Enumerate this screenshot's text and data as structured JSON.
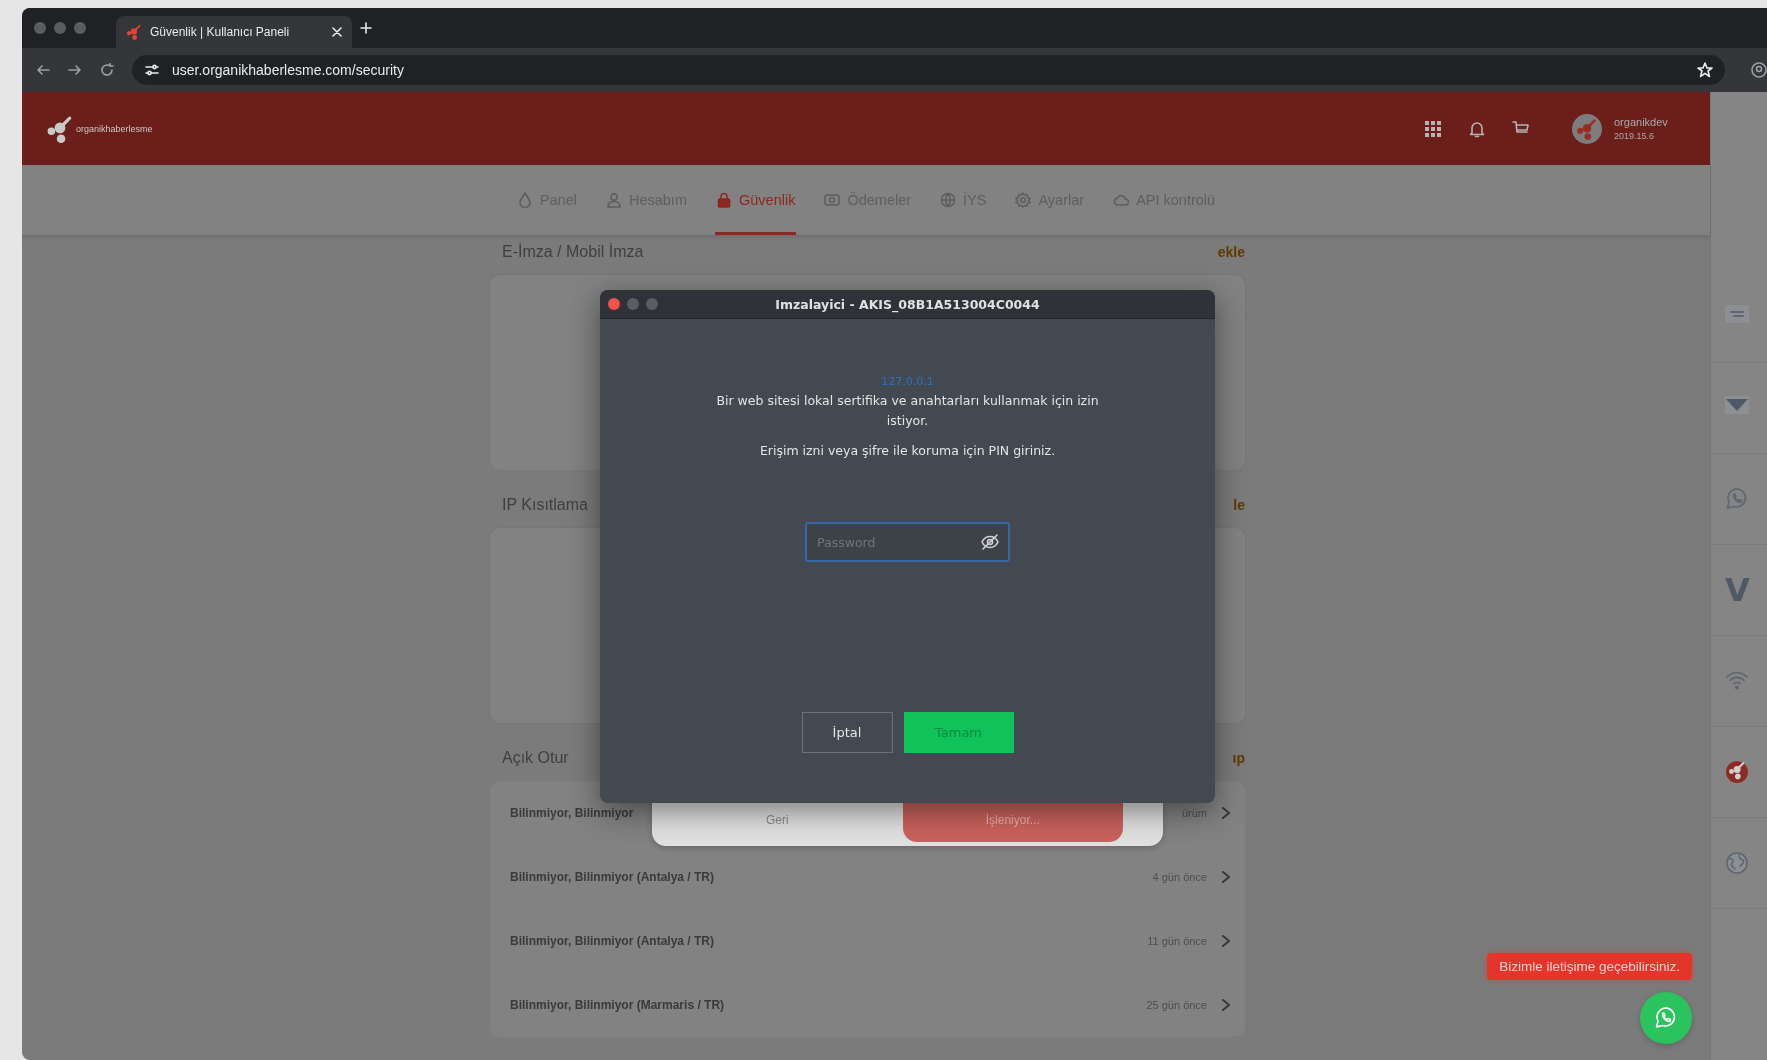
{
  "browser": {
    "tab_title": "Güvenlik | Kullanıcı Paneli",
    "url": "user.organikhaberlesme.com/security"
  },
  "header": {
    "logo_text": "organikhaberlesme",
    "user_name": "organikdev",
    "user_version": "2019.15.6"
  },
  "nav": [
    {
      "label": "Panel",
      "selected": false
    },
    {
      "label": "Hesabım",
      "selected": false
    },
    {
      "label": "Güvenlik",
      "selected": true
    },
    {
      "label": "Ödemeler",
      "selected": false
    },
    {
      "label": "İYS",
      "selected": false
    },
    {
      "label": "Ayarlar",
      "selected": false
    },
    {
      "label": "API kontrolü",
      "selected": false
    }
  ],
  "sections": [
    {
      "title": "E-İmza / Mobil İmza",
      "action": "ekle"
    },
    {
      "title": "IP Kısıtlama",
      "action": "le"
    },
    {
      "title": "Açık Otur",
      "action": "ıp"
    }
  ],
  "sessions": [
    {
      "device": "Bilinmiyor, Bilinmiyor",
      "time": "ürüm"
    },
    {
      "device": "Bilinmiyor, Bilinmiyor (Antalya / TR)",
      "time": "4 gün önce"
    },
    {
      "device": "Bilinmiyor, Bilinmiyor (Antalya / TR)",
      "time": "11 gün önce"
    },
    {
      "device": "Bilinmiyor, Bilinmiyor (Marmaris / TR)",
      "time": "25 gün önce"
    }
  ],
  "back_sheet": {
    "buttons": [
      {
        "label": "Geri",
        "kind": "plain"
      },
      {
        "label": "İşleniyor...",
        "kind": "danger"
      }
    ]
  },
  "dialog": {
    "title": "Imzalayici - AKIS_08B1A513004C0044",
    "host": "127.0.0.1",
    "message": "Bir web sitesi lokal sertifika ve anahtarları kullanmak için izin istiyor.",
    "prompt": "Erişim izni veya şifre ile koruma için PIN giriniz.",
    "password": {
      "placeholder": "Password"
    },
    "buttons": [
      {
        "label": "İptal",
        "kind": "secondary"
      },
      {
        "label": "Tamam",
        "kind": "primary"
      }
    ]
  },
  "side_rail": [
    {
      "kind": "lines"
    },
    {
      "kind": "triangle"
    },
    {
      "kind": "whatsapp"
    },
    {
      "kind": "letter",
      "text": "V"
    },
    {
      "kind": "wifi"
    },
    {
      "kind": "logo"
    },
    {
      "kind": "globe"
    }
  ],
  "contact": {
    "toast": "Bizimle iletişime geçebilirsiniz."
  }
}
